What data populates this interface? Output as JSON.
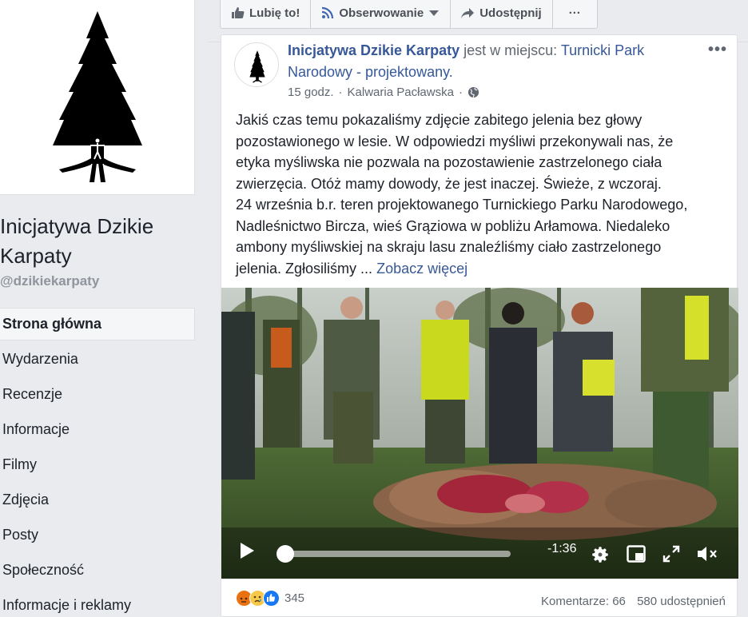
{
  "page": {
    "name": "Inicjatywa Dzikie Karpaty",
    "handle": "@dzikiekarpaty"
  },
  "nav": {
    "items": [
      {
        "label": "Strona główna",
        "active": true
      },
      {
        "label": "Wydarzenia"
      },
      {
        "label": "Recenzje"
      },
      {
        "label": "Informacje"
      },
      {
        "label": "Filmy"
      },
      {
        "label": "Zdjęcia"
      },
      {
        "label": "Posty"
      },
      {
        "label": "Społeczność"
      },
      {
        "label": "Informacje i reklamy"
      }
    ]
  },
  "actions": {
    "like": "Lubię to!",
    "follow": "Obserwowanie",
    "share": "Udostępnij",
    "more": "···"
  },
  "post": {
    "author": "Inicjatywa Dzikie Karpaty",
    "is_at": "jest w miejscu:",
    "place": "Turnicki Park Narodowy - projektowany.",
    "time": "15 godz.",
    "location": "Kalwaria Pacławska",
    "privacy_icon": "globe-icon",
    "more_icon": "•••",
    "text_lines": [
      "Jakiś czas temu pokazaliśmy zdjęcie zabitego jelenia bez głowy",
      "pozostawionego w lesie. W odpowiedzi myśliwi przekonywali nas, że",
      "etyka myśliwska nie pozwala na pozostawienie zastrzelonego ciała",
      "zwierzęcia. Otóż mamy dowody, że jest inaczej. Świeże, z wczoraj.",
      "24 września b.r. teren projektowanego Turnickiego Parku Narodowego,",
      "Nadleśnictwo Bircza, wieś Grąziowa w pobliżu Arłamowa. Niedaleko",
      "ambony myśliwskiej na skraju lasu znaleźliśmy ciało zastrzelonego",
      "jelenia. Zgłosiliśmy ..."
    ],
    "see_more": "Zobacz więcej"
  },
  "video": {
    "time_remaining": "-1:36",
    "progress": 0.04
  },
  "footer": {
    "reaction_icons": [
      "angry-icon",
      "sad-icon",
      "like-icon"
    ],
    "reaction_count": "345",
    "comments": "Komentarze: 66",
    "shares": "580 udostępnień"
  },
  "colors": {
    "link": "#365899",
    "background": "#e9ebee",
    "card": "#ffffff",
    "muted": "#606770"
  }
}
